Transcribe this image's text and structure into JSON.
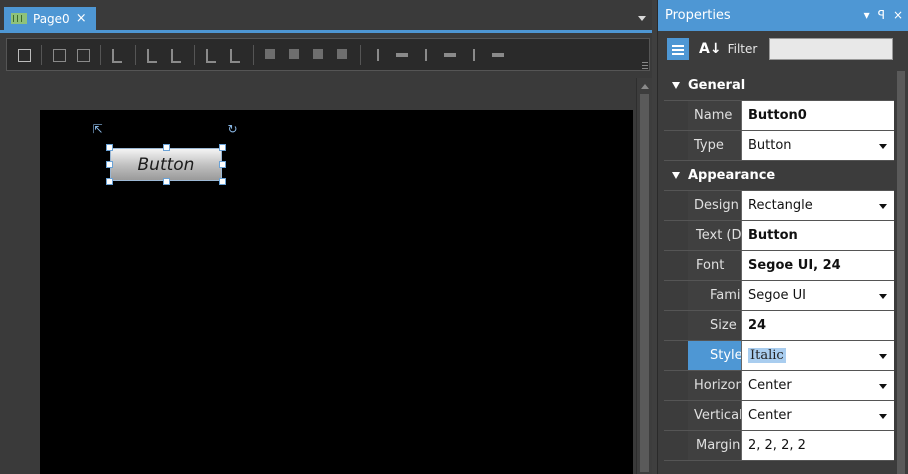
{
  "editor": {
    "tab": {
      "title": "Page0",
      "close": "×"
    },
    "canvas_button": {
      "label": "Button"
    }
  },
  "properties": {
    "title": "Properties",
    "controls": {
      "dropdown": "▾",
      "pin": "ᵠ",
      "close": "×"
    },
    "filter_label": "Filter",
    "filter_value": "",
    "sort_glyph": "A↓Z",
    "rows": {
      "general": "General",
      "name_label": "Name",
      "name_value": "Button0",
      "type_label": "Type",
      "type_value": "Button",
      "appearance": "Appearance",
      "design_label": "Design",
      "design_value": "Rectangle",
      "text_label": "Text (Defa",
      "text_value": "Button",
      "font_label": "Font",
      "font_value": "Segoe UI, 24",
      "family_label": "Family",
      "family_value": "Segoe UI",
      "size_label": "Size",
      "size_value": "24",
      "style_label": "Style",
      "style_value": "Italic",
      "horizontal_label": "Horizontal",
      "horizontal_value": "Center",
      "vertical_label": "VerticalAli",
      "vertical_value": "Center",
      "margins_label": "Margins (I",
      "margins_value": "2, 2, 2, 2"
    }
  },
  "colors": {
    "accent": "#4e97d4",
    "canvas": "#000000",
    "panel": "#3c3c3c"
  },
  "icons": [
    "page-grid-icon",
    "tab-close-icon",
    "categorized-icon",
    "sort-alpha-icon",
    "pin-icon",
    "close-icon",
    "rotate-handle-icon",
    "dropdown-arrow-icon"
  ]
}
